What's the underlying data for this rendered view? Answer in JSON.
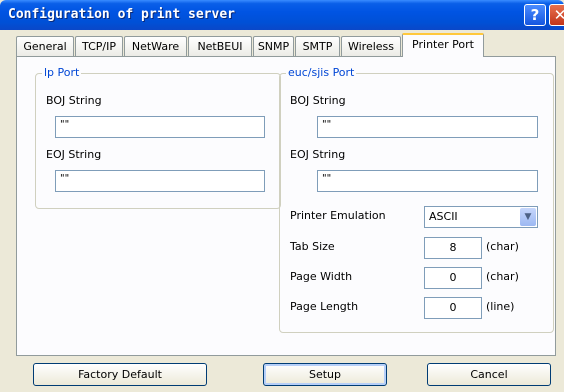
{
  "window": {
    "title": "Configuration of print server"
  },
  "tabs": [
    "General",
    "TCP/IP",
    "NetWare",
    "NetBEUI",
    "SNMP",
    "SMTP",
    "Wireless",
    "Printer Port"
  ],
  "active_tab": "Printer Port",
  "lp_port": {
    "title": "lp Port",
    "boj_label": "BOJ String",
    "boj_value": "\"\"",
    "eoj_label": "EOJ String",
    "eoj_value": "\"\""
  },
  "euc_port": {
    "title": "euc/sjis Port",
    "boj_label": "BOJ String",
    "boj_value": "\"\"",
    "eoj_label": "EOJ String",
    "eoj_value": "\"\"",
    "emulation_label": "Printer Emulation",
    "emulation_value": "ASCII",
    "tab_size_label": "Tab Size",
    "tab_size_value": "8",
    "tab_size_unit": "(char)",
    "page_width_label": "Page Width",
    "page_width_value": "0",
    "page_width_unit": "(char)",
    "page_length_label": "Page Length",
    "page_length_value": "0",
    "page_length_unit": "(line)"
  },
  "buttons": {
    "factory_default": "Factory Default",
    "setup": "Setup",
    "cancel": "Cancel"
  },
  "icons": {
    "help": "help-icon",
    "close": "close-icon",
    "dropdown": "chevron-down-icon"
  },
  "colors": {
    "titlebar": "#0054e3",
    "group_label": "#0046d5",
    "active_tab_accent": "#ffc83c"
  }
}
